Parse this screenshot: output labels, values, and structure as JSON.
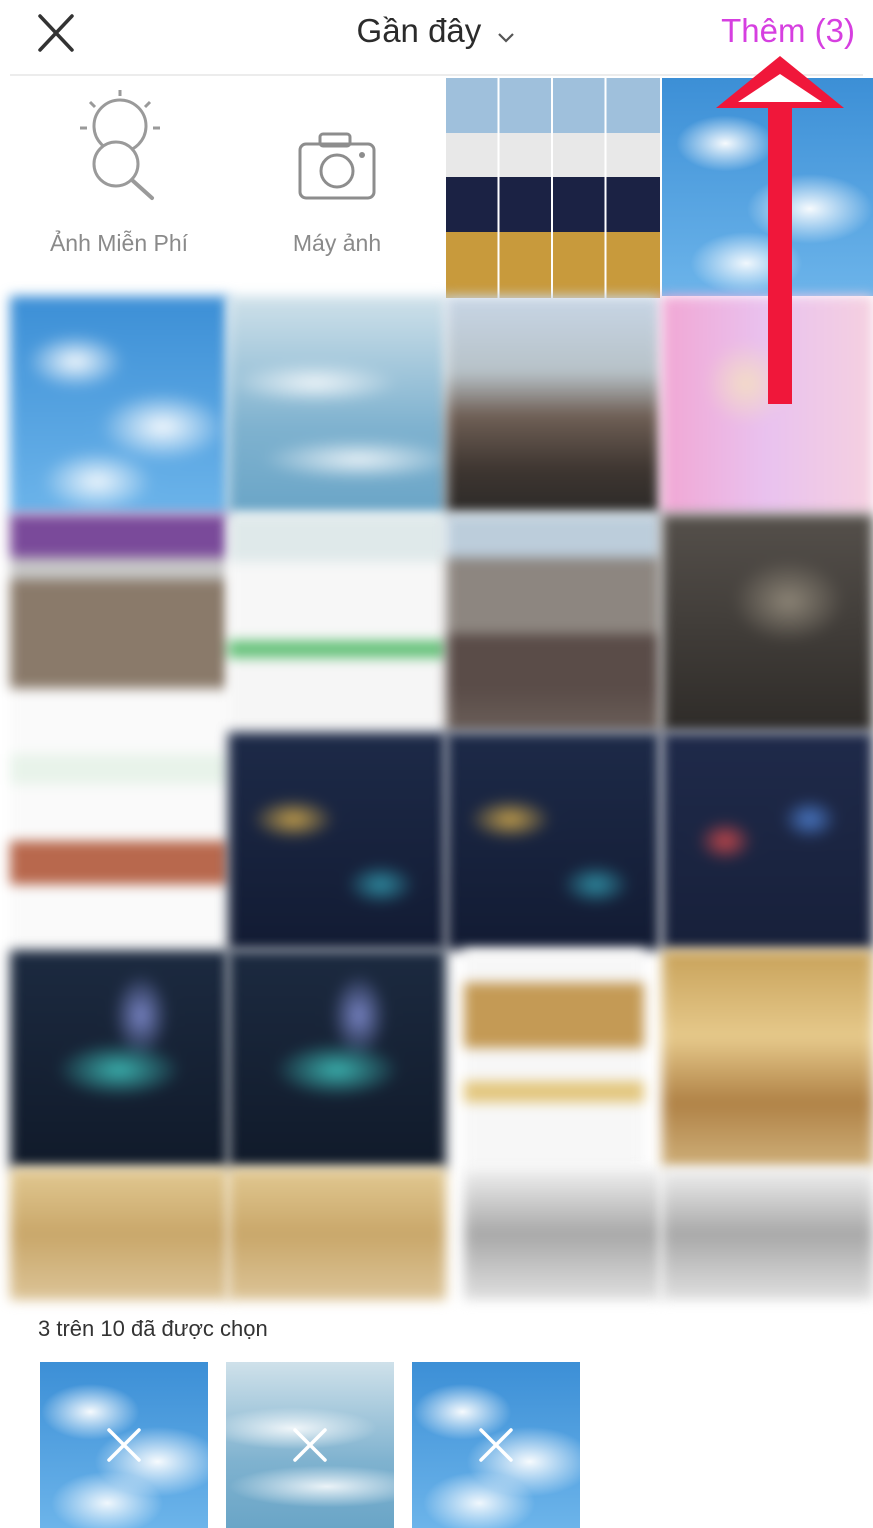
{
  "header": {
    "album_title": "Gần đây",
    "add_button_label": "Thêm (3)",
    "add_button_color": "#d63fe0"
  },
  "tools": [
    {
      "label": "Ảnh Miễn Phí",
      "icon": "free-photo-search-icon"
    },
    {
      "label": "Máy ảnh",
      "icon": "camera-icon"
    }
  ],
  "selection": {
    "count_text": "3 trên 10 đã được chọn",
    "selected": 3,
    "max": 10
  },
  "accent": {
    "arrow_color": "#f0173a"
  }
}
